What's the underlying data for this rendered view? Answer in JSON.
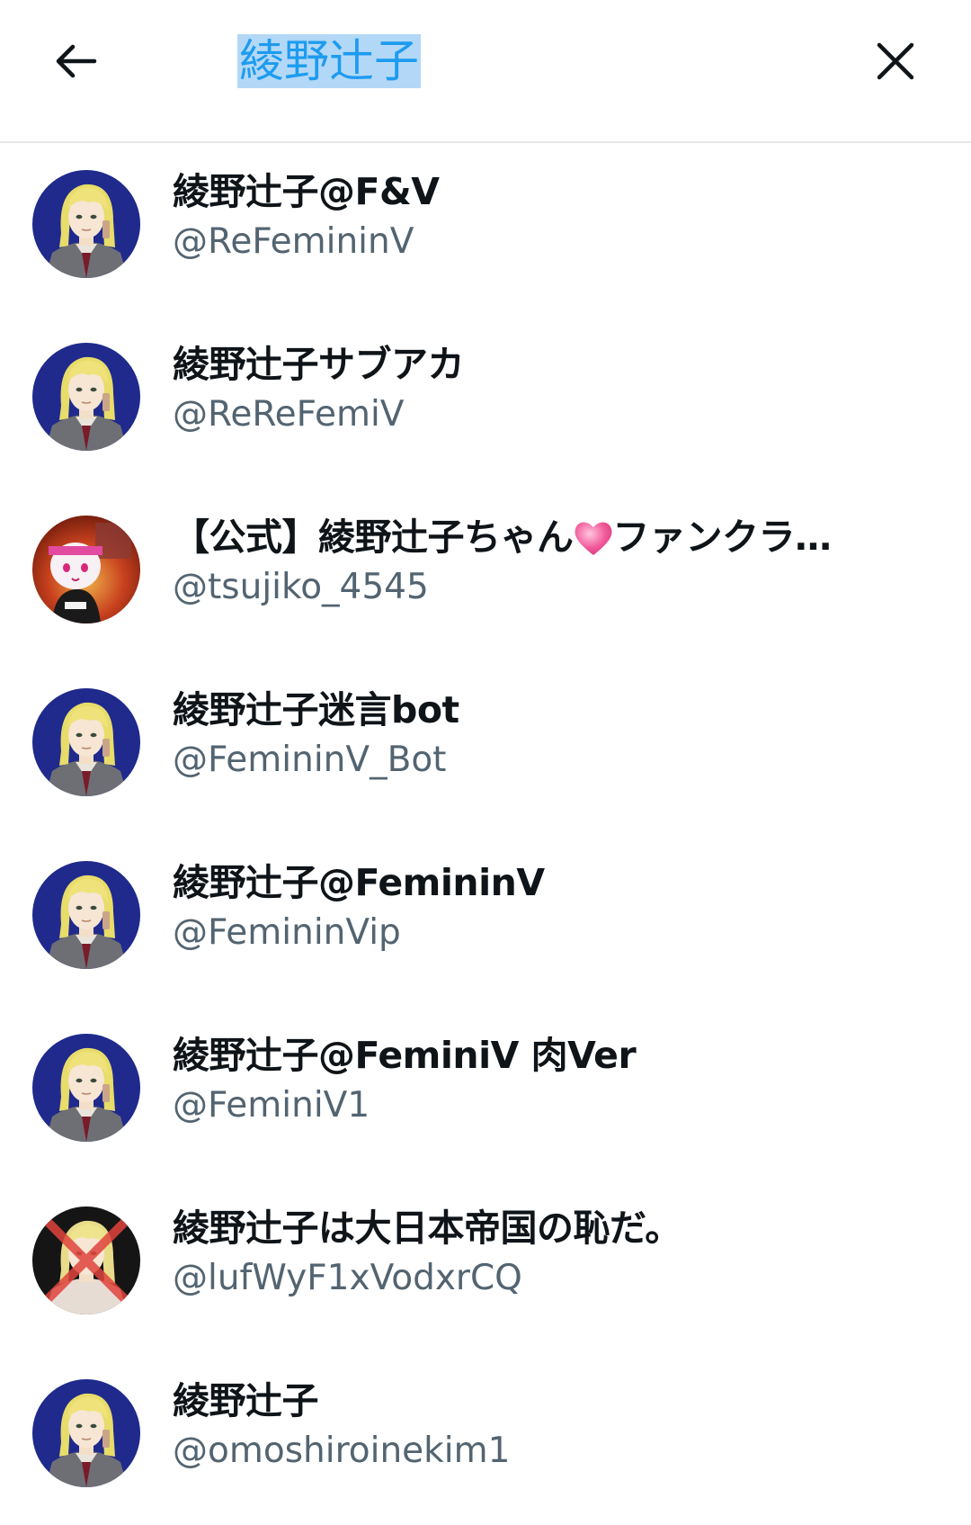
{
  "header": {
    "back_icon": "arrow-left-icon",
    "search_query": "綾野辻子",
    "close_icon": "close-icon"
  },
  "results": [
    {
      "name": "綾野辻子@F&V",
      "handle": "@ReFemininV",
      "avatar": "blonde-character"
    },
    {
      "name": "綾野辻子サブアカ",
      "handle": "@ReReFemiV",
      "avatar": "blonde-character"
    },
    {
      "name_prefix": "【公式】綾野辻子ちゃん",
      "name_suffix": "ファンクラ…",
      "name_emoji": "pink-heart-emoji",
      "handle": "@tsujiko_4545",
      "avatar": "mascot-character"
    },
    {
      "name": "綾野辻子迷言bot",
      "handle": "@FemininV_Bot",
      "avatar": "blonde-character"
    },
    {
      "name": "綾野辻子@FemininV",
      "handle": "@FemininVip",
      "avatar": "blonde-character"
    },
    {
      "name": "綾野辻子@FeminiV 肉Ver",
      "handle": "@FeminiV1",
      "avatar": "blonde-character"
    },
    {
      "name": "綾野辻子は大日本帝国の恥だ。",
      "handle": "@lufWyF1xVodxrCQ",
      "avatar": "crossed-out-character"
    },
    {
      "name": "綾野辻子",
      "handle": "@omoshiroinekim1",
      "avatar": "blonde-character"
    }
  ],
  "colors": {
    "accent": "#1d9bf0",
    "selection": "#b3d8f7",
    "handle_gray": "#536471",
    "avatar_bg": "#1e2a8a"
  }
}
